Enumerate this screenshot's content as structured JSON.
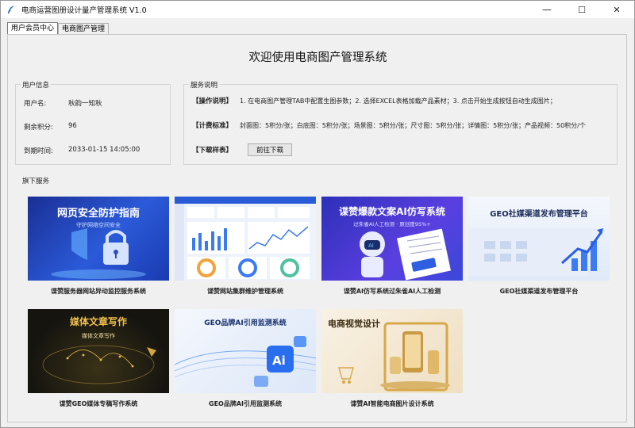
{
  "window": {
    "title": "电商运营图册设计量产管理系统 V1.0",
    "minimize": "—",
    "maximize": "☐",
    "close": "✕"
  },
  "tabs": [
    {
      "label": "用户会员中心",
      "active": true
    },
    {
      "label": "电商图产管理",
      "active": false
    }
  ],
  "welcome": "欢迎使用电商图产管理系统",
  "user_info": {
    "title": "用户信息",
    "rows": [
      {
        "key": "用户名:",
        "value": "秋韵一知秋"
      },
      {
        "key": "剩余积分:",
        "value": "96"
      },
      {
        "key": "到期时间:",
        "value": "2033-01-15 14:05:00"
      }
    ]
  },
  "service_desc": {
    "title": "服务说明",
    "operation_key": "【操作说明】",
    "operation_text": "1. 在电商图产管理TAB中配置生图参数；2. 选择EXCEL表格加载产品素材；3. 点击开始生成按钮自动生成图片；",
    "pricing_key": "【计费标准】",
    "pricing_items": [
      "封面图：5积分/张；",
      "白底图：5积分/张；",
      "场景图：5积分/张；",
      "尺寸图：5积分/张；",
      "详情图：5积分/张；",
      "产品视频：50积分/个"
    ],
    "download_key": "【下载样表】",
    "download_button": "前往下载"
  },
  "flagship": {
    "title": "旗下服务",
    "cards": [
      {
        "caption": "谍赞服务器网站异动监控服务系统",
        "image_title": "网页安全防护指南",
        "image_sub": "守护网络空间安全",
        "icon": "shield-lock-icon"
      },
      {
        "caption": "谍赞网站集群维护管理系统",
        "image_title": "",
        "image_sub": "",
        "icon": "dashboard-icon"
      },
      {
        "caption": "谍赞AI仿写系统过朱雀AI人工检测",
        "image_title": "谍赞爆款文案AI仿写系统",
        "image_sub": "过朱雀AI人工检测 · 原创度95%+",
        "icon": "robot-icon"
      },
      {
        "caption": "GEO社媒渠道发布管理平台",
        "image_title": "GEO社媒渠道发布管理平台",
        "image_sub": "",
        "icon": "rising-chart-icon"
      },
      {
        "caption": "谍赞GEO媒体专稿写作系统",
        "image_title": "媒体文章写作",
        "image_sub": "媒体文章写作",
        "icon": "world-map-icon"
      },
      {
        "caption": "GEO品牌AI引用监测系统",
        "image_title": "GEO品牌AI引用监测系统",
        "image_sub": "",
        "icon": "ai-chip-icon"
      },
      {
        "caption": "谍赞AI智能电商图片设计系统",
        "image_title": "电商视觉设计",
        "image_sub": "",
        "icon": "phone-products-icon"
      }
    ]
  },
  "colors": {
    "window_bg": "#f0f0f0",
    "card1_bg": "#1f3fa8",
    "card3_bg": "#3b3fd0",
    "card5_bg": "#1c1a12",
    "card7_bg": "#f5ead7",
    "gold": "#f2c14e"
  }
}
